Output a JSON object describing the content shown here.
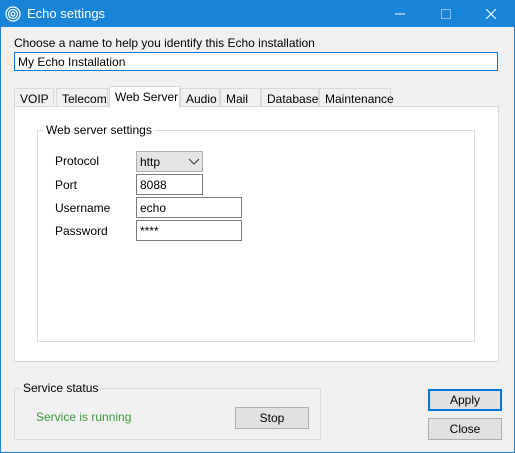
{
  "window": {
    "title": "Echo settings",
    "icon": "echo-app-icon",
    "controls": {
      "minimize_icon": "minimize-icon",
      "maximize_icon": "maximize-icon",
      "close_icon": "close-icon"
    }
  },
  "installation": {
    "prompt": "Choose a name to help you identify this Echo installation",
    "name_value": "My Echo Installation"
  },
  "tabs": [
    {
      "label": "VOIP"
    },
    {
      "label": "Telecom"
    },
    {
      "label": "Web Server",
      "active": true
    },
    {
      "label": "Audio"
    },
    {
      "label": "Mail"
    },
    {
      "label": "Database"
    },
    {
      "label": "Maintenance"
    }
  ],
  "web_server": {
    "group_title": "Web server settings",
    "protocol_label": "Protocol",
    "protocol_value": "http",
    "port_label": "Port",
    "port_value": "8088",
    "username_label": "Username",
    "username_value": "echo",
    "password_label": "Password",
    "password_value": "****"
  },
  "service": {
    "group_title": "Service status",
    "status_text": "Service is running",
    "status_color": "#3c9b3c",
    "stop_label": "Stop"
  },
  "actions": {
    "apply_label": "Apply",
    "close_label": "Close"
  },
  "colors": {
    "titlebar": "#1883d7",
    "accent": "#0078d7"
  }
}
